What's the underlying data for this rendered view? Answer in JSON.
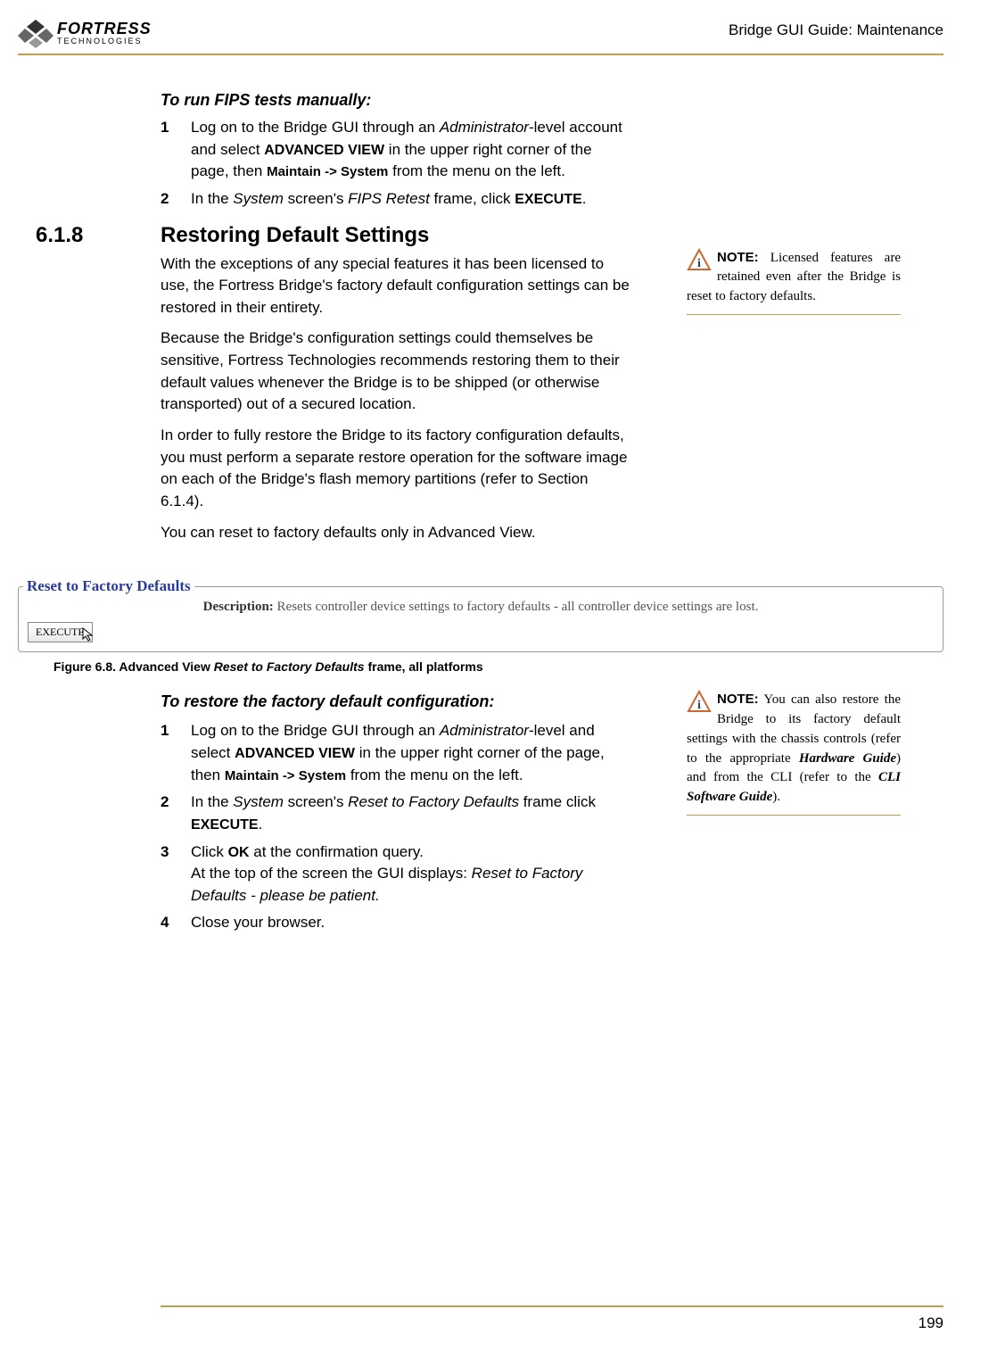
{
  "header": {
    "logo_top": "FORTRESS",
    "logo_sub": "TECHNOLOGIES",
    "right": "Bridge GUI Guide: Maintenance"
  },
  "fips": {
    "title": "To run FIPS tests manually:",
    "step1_pre": "Log on to the Bridge GUI through an ",
    "step1_em1": "Administrator",
    "step1_mid1": "-level account and select ",
    "step1_sc1": "ADVANCED VIEW",
    "step1_mid2": " in the upper right corner of the page, then ",
    "step1_b1": "Maintain -> System",
    "step1_post": " from the menu on the left.",
    "step2_pre": "In the ",
    "step2_em1": "System",
    "step2_mid1": " screen's ",
    "step2_em2": "FIPS Retest",
    "step2_mid2": " frame, click ",
    "step2_sc1": "EXECUTE",
    "step2_post": "."
  },
  "section": {
    "num": "6.1.8",
    "title": "Restoring Default Settings"
  },
  "body": {
    "p1": "With the exceptions of any special features it has been licensed to use, the Fortress Bridge's factory default configuration settings can be restored in their entirety.",
    "p2": "Because the Bridge's configuration settings could themselves be sensitive, Fortress Technologies recommends restoring them to their default values whenever the Bridge is to be shipped (or otherwise transported) out of a secured location.",
    "p3": "In order to fully restore the Bridge to its factory configuration defaults, you must perform a separate restore operation for the software image on each of the Bridge's flash memory partitions (refer to Section 6.1.4).",
    "p4": "You can reset to factory defaults only in Advanced View."
  },
  "note1": {
    "label": "NOTE:",
    "text": " Licensed features are retained even after the Bridge is reset to factory defaults."
  },
  "fieldset": {
    "legend": "Reset to Factory Defaults",
    "desc_label": "Description:",
    "desc_text": " Resets controller device settings to factory defaults - all controller device settings are lost.",
    "button": "EXECUTE"
  },
  "figcaption": {
    "num": "Figure 6.8.",
    "pre": " Advanced View ",
    "em": "Reset to Factory Defaults",
    "post": " frame, all platforms"
  },
  "restore": {
    "title": "To restore the factory default configuration:",
    "s1_pre": "Log on to the Bridge GUI through an ",
    "s1_em1": "Administrator",
    "s1_mid1": "-level and select ",
    "s1_sc1": "ADVANCED VIEW",
    "s1_mid2": " in the upper right corner of the page, then ",
    "s1_b1": "Maintain -> System",
    "s1_post": " from the menu on the left.",
    "s2_pre": "In the ",
    "s2_em1": "System",
    "s2_mid1": " screen's ",
    "s2_em2": "Reset to Factory Defaults",
    "s2_mid2": " frame click ",
    "s2_sc1": "EXECUTE",
    "s2_post": ".",
    "s3_pre": "Click ",
    "s3_sc1": "OK",
    "s3_post": " at the confirmation query.",
    "s3_p2_pre": "At the top of the screen the GUI displays: ",
    "s3_p2_em": "Reset to Factory Defaults - please be patient.",
    "s4": "Close your browser."
  },
  "note2": {
    "label": "NOTE:",
    "t1": " You can also restore the Bridge to its factory default settings with the chassis controls (refer to the appropriate ",
    "em1": "Hardware Guide",
    "t2": ") and from the CLI (refer to the ",
    "em2": "CLI Software Guide",
    "t3": ")."
  },
  "footer": {
    "page": "199"
  }
}
